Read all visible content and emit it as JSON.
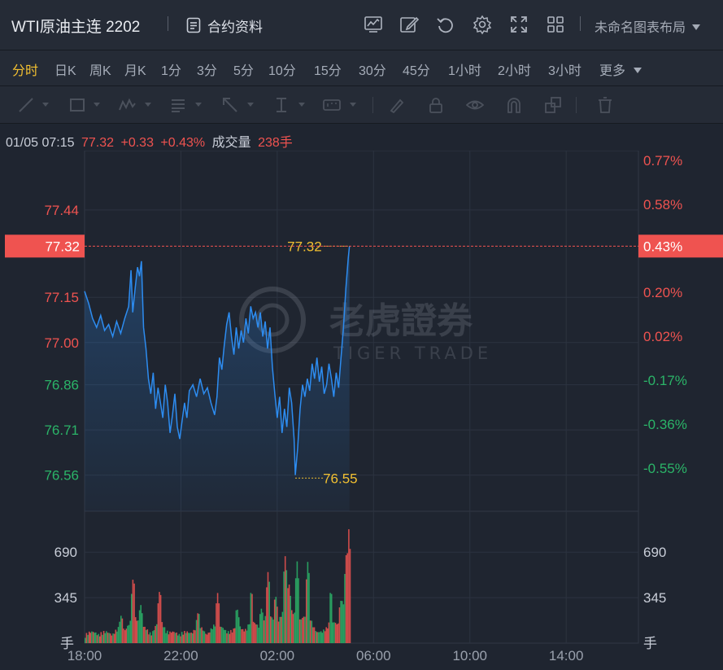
{
  "header": {
    "title": "WTI原油主连 2202",
    "contract_label": "合约资料",
    "layout_name": "未命名图表布局",
    "icons": [
      "chart-template-icon",
      "pencil-icon",
      "undo-icon",
      "settings-icon",
      "fullscreen-icon",
      "grid-layout-icon"
    ]
  },
  "periods": {
    "items": [
      "分时",
      "日K",
      "周K",
      "月K",
      "1分",
      "3分",
      "5分",
      "10分",
      "15分",
      "30分",
      "45分",
      "1小时",
      "2小时",
      "3小时",
      "更多"
    ],
    "active_index": 0
  },
  "tools": {
    "icons": [
      "trendline-icon",
      "rectangle-icon",
      "wave-icon",
      "fib-icon",
      "arrow-icon",
      "vertical-line-icon",
      "number-tag-icon",
      "brush-icon",
      "lock-icon",
      "eye-icon",
      "magnet-icon",
      "group-icon",
      "trash-icon"
    ]
  },
  "info": {
    "datetime": "01/05 07:15",
    "price": "77.32",
    "change": "+0.33",
    "change_pct": "+0.43%",
    "volume_label": "成交量",
    "volume": "238手"
  },
  "colors": {
    "up": "#ef5350",
    "down": "#2bb468",
    "line": "#2d8cf0",
    "accent": "#f2c031",
    "background": "#1f2530"
  },
  "watermark": {
    "brand": "老虎證券",
    "brand_en": "TIGER TRADE"
  },
  "chart_data": {
    "type": "line",
    "x_ticks": [
      "18:00",
      "22:00",
      "02:00",
      "06:00",
      "10:00",
      "14:00"
    ],
    "x_range_hours": [
      0,
      23
    ],
    "y_ticks": [
      "77.44",
      "77.15",
      "77.00",
      "76.86",
      "76.71",
      "76.56"
    ],
    "y_range": [
      76.44,
      77.61
    ],
    "pct_ticks": [
      "0.77%",
      "0.58%",
      "0.20%",
      "0.02%",
      "-0.17%",
      "-0.36%",
      "-0.55%"
    ],
    "current_price": "77.32",
    "current_pct": "0.43%",
    "high_marker": "77.32",
    "low_marker": "76.55",
    "series": [
      {
        "points": [
          [
            0,
            77.17
          ],
          [
            0.17,
            77.13
          ],
          [
            0.33,
            77.08
          ],
          [
            0.5,
            77.05
          ],
          [
            0.67,
            77.09
          ],
          [
            0.83,
            77.04
          ],
          [
            1.0,
            77.06
          ],
          [
            1.17,
            77.02
          ],
          [
            1.33,
            77.07
          ],
          [
            1.5,
            77.03
          ],
          [
            1.67,
            77.08
          ],
          [
            1.83,
            77.12
          ],
          [
            1.93,
            77.24
          ],
          [
            2.0,
            77.1
          ],
          [
            2.1,
            77.18
          ],
          [
            2.2,
            77.25
          ],
          [
            2.28,
            77.22
          ],
          [
            2.36,
            77.27
          ],
          [
            2.45,
            77.05
          ],
          [
            2.55,
            76.98
          ],
          [
            2.65,
            76.88
          ],
          [
            2.75,
            76.83
          ],
          [
            2.85,
            76.9
          ],
          [
            2.95,
            76.78
          ],
          [
            3.05,
            76.85
          ],
          [
            3.15,
            76.8
          ],
          [
            3.25,
            76.75
          ],
          [
            3.35,
            76.86
          ],
          [
            3.45,
            76.8
          ],
          [
            3.55,
            76.7
          ],
          [
            3.65,
            76.76
          ],
          [
            3.75,
            76.83
          ],
          [
            3.85,
            76.72
          ],
          [
            3.95,
            76.68
          ],
          [
            4.05,
            76.74
          ],
          [
            4.15,
            76.8
          ],
          [
            4.25,
            76.75
          ],
          [
            4.35,
            76.84
          ],
          [
            4.5,
            76.86
          ],
          [
            4.65,
            76.82
          ],
          [
            4.8,
            76.88
          ],
          [
            4.95,
            76.83
          ],
          [
            5.1,
            76.85
          ],
          [
            5.25,
            76.8
          ],
          [
            5.4,
            76.76
          ],
          [
            5.5,
            76.82
          ],
          [
            5.6,
            76.95
          ],
          [
            5.7,
            76.91
          ],
          [
            5.8,
            76.99
          ],
          [
            5.9,
            77.06
          ],
          [
            6.0,
            77.1
          ],
          [
            6.1,
            77.02
          ],
          [
            6.2,
            76.96
          ],
          [
            6.3,
            77.05
          ],
          [
            6.4,
            76.98
          ],
          [
            6.5,
            77.04
          ],
          [
            6.6,
            77.0
          ],
          [
            6.7,
            77.08
          ],
          [
            6.8,
            77.03
          ],
          [
            6.9,
            77.12
          ],
          [
            7.0,
            77.08
          ],
          [
            7.1,
            77.1
          ],
          [
            7.2,
            77.05
          ],
          [
            7.3,
            77.1
          ],
          [
            7.4,
            77.02
          ],
          [
            7.5,
            77.07
          ],
          [
            7.6,
            76.98
          ],
          [
            7.7,
            77.05
          ],
          [
            7.8,
            76.92
          ],
          [
            7.9,
            76.83
          ],
          [
            8.0,
            76.75
          ],
          [
            8.1,
            76.82
          ],
          [
            8.2,
            76.7
          ],
          [
            8.3,
            76.78
          ],
          [
            8.4,
            76.72
          ],
          [
            8.5,
            76.85
          ],
          [
            8.6,
            76.8
          ],
          [
            8.7,
            76.68
          ],
          [
            8.75,
            76.56
          ],
          [
            8.85,
            76.65
          ],
          [
            8.95,
            76.78
          ],
          [
            9.05,
            76.86
          ],
          [
            9.15,
            76.82
          ],
          [
            9.25,
            76.88
          ],
          [
            9.35,
            76.84
          ],
          [
            9.45,
            76.93
          ],
          [
            9.55,
            76.88
          ],
          [
            9.65,
            76.95
          ],
          [
            9.75,
            76.87
          ],
          [
            9.85,
            76.92
          ],
          [
            9.95,
            76.83
          ],
          [
            10.05,
            76.86
          ],
          [
            10.15,
            76.93
          ],
          [
            10.25,
            76.88
          ],
          [
            10.35,
            76.82
          ],
          [
            10.45,
            76.9
          ],
          [
            10.55,
            76.85
          ],
          [
            10.65,
            76.95
          ],
          [
            10.75,
            77.05
          ],
          [
            10.85,
            77.18
          ],
          [
            10.95,
            77.28
          ],
          [
            11.0,
            77.32
          ]
        ]
      }
    ],
    "volume": {
      "y_ticks": [
        "690",
        "345"
      ],
      "y_range": [
        0,
        1000
      ],
      "unit": "手",
      "bars_hours_end": 11.0,
      "peaks": [
        [
          1.5,
          220
        ],
        [
          2.0,
          520
        ],
        [
          2.3,
          300
        ],
        [
          3.1,
          420
        ],
        [
          4.7,
          250
        ],
        [
          5.5,
          380
        ],
        [
          6.3,
          280
        ],
        [
          6.9,
          420
        ],
        [
          7.3,
          260
        ],
        [
          7.6,
          560
        ],
        [
          7.9,
          380
        ],
        [
          8.3,
          660
        ],
        [
          8.45,
          480
        ],
        [
          8.8,
          620
        ],
        [
          9.25,
          640
        ],
        [
          10.2,
          420
        ],
        [
          10.6,
          300
        ],
        [
          10.85,
          600
        ],
        [
          10.95,
          880
        ]
      ]
    }
  }
}
